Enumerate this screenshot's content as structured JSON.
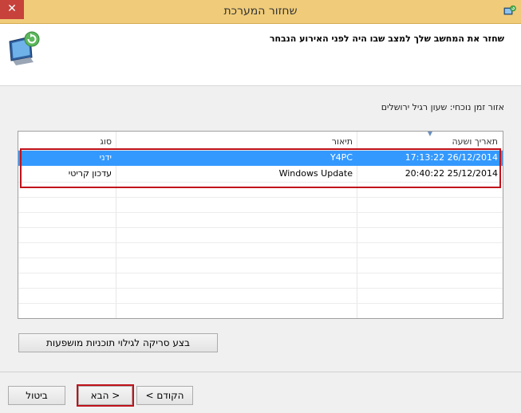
{
  "window": {
    "title": "שחזור המערכת",
    "close_glyph": "✕"
  },
  "header": {
    "instruction": "שחזר את המחשב שלך למצב שבו היה לפני האירוע הנבחר"
  },
  "timezone_text": "אזור זמן נוכחי: שעון רגיל ירושלים",
  "table": {
    "columns": {
      "date": "תאריך ושעה",
      "description": "תיאור",
      "type": "סוג"
    },
    "rows": [
      {
        "date": "17:13:22 26/12/2014",
        "description": "Y4PC",
        "type": "ידני",
        "selected": true
      },
      {
        "date": "20:40:22 25/12/2014",
        "description": "Windows Update",
        "type": "עדכון קריטי",
        "selected": false
      }
    ]
  },
  "buttons": {
    "scan": "בצע סריקה לגילוי תוכניות מושפעות",
    "back": "< הקודם",
    "next": "הבא >",
    "cancel": "ביטול"
  },
  "colors": {
    "titlebar": "#f0cc7a",
    "selection": "#3399ff",
    "highlight": "#c0121c"
  },
  "icons": [
    "close-icon",
    "system-restore-icon",
    "computer-restore-icon",
    "sort-arrow-icon"
  ]
}
